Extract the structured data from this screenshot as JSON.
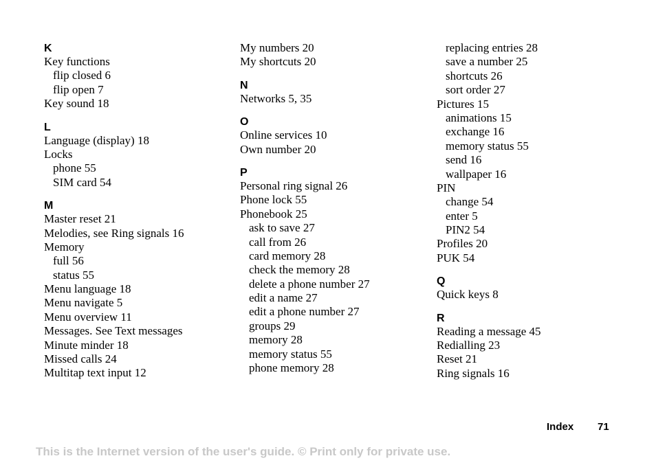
{
  "columns": [
    [
      {
        "type": "heading",
        "text": "K"
      },
      {
        "type": "item",
        "text": "Key functions"
      },
      {
        "type": "sub",
        "text": "flip closed 6"
      },
      {
        "type": "sub",
        "text": "flip open 7"
      },
      {
        "type": "item",
        "text": "Key sound 18"
      },
      {
        "type": "heading",
        "text": "L"
      },
      {
        "type": "item",
        "text": "Language (display) 18"
      },
      {
        "type": "item",
        "text": "Locks"
      },
      {
        "type": "sub",
        "text": "phone 55"
      },
      {
        "type": "sub",
        "text": "SIM card 54"
      },
      {
        "type": "heading",
        "text": "M"
      },
      {
        "type": "item",
        "text": "Master reset 21"
      },
      {
        "type": "item",
        "text": "Melodies, see Ring signals 16"
      },
      {
        "type": "item",
        "text": "Memory"
      },
      {
        "type": "sub",
        "text": "full 56"
      },
      {
        "type": "sub",
        "text": "status 55"
      },
      {
        "type": "item",
        "text": "Menu language 18"
      },
      {
        "type": "item",
        "text": "Menu navigate 5"
      },
      {
        "type": "item",
        "text": "Menu overview 11"
      },
      {
        "type": "item",
        "text": "Messages. See Text messages"
      },
      {
        "type": "item",
        "text": "Minute minder 18"
      },
      {
        "type": "item",
        "text": "Missed calls 24"
      },
      {
        "type": "item",
        "text": "Multitap text input 12"
      }
    ],
    [
      {
        "type": "item",
        "text": "My numbers 20"
      },
      {
        "type": "item",
        "text": "My shortcuts 20"
      },
      {
        "type": "heading",
        "text": "N"
      },
      {
        "type": "item",
        "text": "Networks 5, 35"
      },
      {
        "type": "heading",
        "text": "O"
      },
      {
        "type": "item",
        "text": "Online services 10"
      },
      {
        "type": "item",
        "text": "Own number 20"
      },
      {
        "type": "heading",
        "text": "P"
      },
      {
        "type": "item",
        "text": "Personal ring signal 26"
      },
      {
        "type": "item",
        "text": "Phone lock 55"
      },
      {
        "type": "item",
        "text": "Phonebook 25"
      },
      {
        "type": "sub",
        "text": "ask to save 27"
      },
      {
        "type": "sub",
        "text": "call from 26"
      },
      {
        "type": "sub",
        "text": "card memory 28"
      },
      {
        "type": "sub",
        "text": "check the memory 28"
      },
      {
        "type": "sub",
        "text": "delete a phone number 27"
      },
      {
        "type": "sub",
        "text": "edit a name 27"
      },
      {
        "type": "sub",
        "text": "edit a phone number 27"
      },
      {
        "type": "sub",
        "text": "groups 29"
      },
      {
        "type": "sub",
        "text": "memory 28"
      },
      {
        "type": "sub",
        "text": "memory status 55"
      },
      {
        "type": "sub",
        "text": "phone memory 28"
      }
    ],
    [
      {
        "type": "sub",
        "text": "replacing entries 28"
      },
      {
        "type": "sub",
        "text": "save a number 25"
      },
      {
        "type": "sub",
        "text": "shortcuts 26"
      },
      {
        "type": "sub",
        "text": "sort order 27"
      },
      {
        "type": "item",
        "text": "Pictures 15"
      },
      {
        "type": "sub",
        "text": "animations 15"
      },
      {
        "type": "sub",
        "text": "exchange 16"
      },
      {
        "type": "sub",
        "text": "memory status 55"
      },
      {
        "type": "sub",
        "text": "send 16"
      },
      {
        "type": "sub",
        "text": "wallpaper 16"
      },
      {
        "type": "item",
        "text": "PIN"
      },
      {
        "type": "sub",
        "text": "change 54"
      },
      {
        "type": "sub",
        "text": "enter 5"
      },
      {
        "type": "sub",
        "text": "PIN2 54"
      },
      {
        "type": "item",
        "text": "Profiles 20"
      },
      {
        "type": "item",
        "text": "PUK 54"
      },
      {
        "type": "heading",
        "text": "Q"
      },
      {
        "type": "item",
        "text": "Quick keys 8"
      },
      {
        "type": "heading",
        "text": "R"
      },
      {
        "type": "item",
        "text": "Reading a message 45"
      },
      {
        "type": "item",
        "text": "Redialling 23"
      },
      {
        "type": "item",
        "text": "Reset 21"
      },
      {
        "type": "item",
        "text": "Ring signals 16"
      }
    ]
  ],
  "footer": {
    "section": "Index",
    "page": "71",
    "notice": "This is the Internet version of the user's guide. © Print only for private use."
  },
  "colors": {
    "text": "#000000",
    "notice": "#c8c8c8"
  }
}
